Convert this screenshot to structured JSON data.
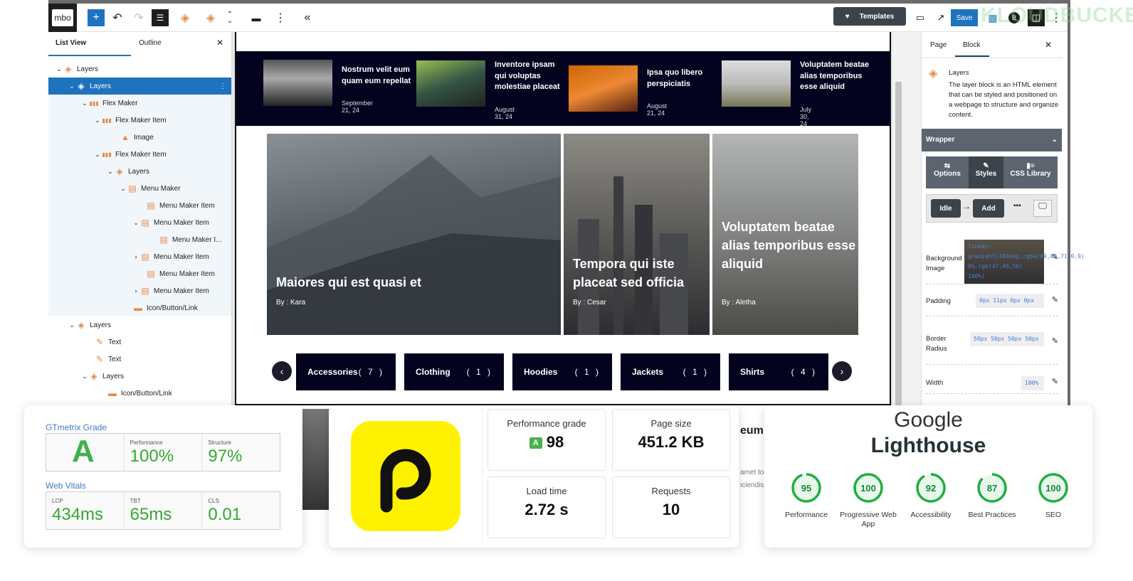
{
  "toolbar": {
    "logo": "mbo",
    "add": "+",
    "undo": "↶",
    "redo": "↷",
    "more": "⋮",
    "collapse": "«",
    "templates": "Templates",
    "save": "Save",
    "watermark": "KLOUDBUCKET"
  },
  "left": {
    "tabs": [
      "List View",
      "Outline"
    ],
    "close": "✕",
    "tree": [
      {
        "label": "Layers",
        "level": 0,
        "chev": "down",
        "icon": "layers"
      },
      {
        "label": "Layers",
        "level": 1,
        "chev": "down",
        "icon": "layers",
        "selected": true
      },
      {
        "label": "Flex Maker",
        "level": 2,
        "chev": "down",
        "icon": "flex"
      },
      {
        "label": "Flex Maker Item",
        "level": 3,
        "chev": "down",
        "icon": "flex"
      },
      {
        "label": "Image",
        "level": 4,
        "chev": "",
        "icon": "image"
      },
      {
        "label": "Flex Maker Item",
        "level": 3,
        "chev": "down",
        "icon": "flex"
      },
      {
        "label": "Layers",
        "level": 4,
        "chev": "down",
        "icon": "layers"
      },
      {
        "label": "Menu Maker",
        "level": 5,
        "chev": "down",
        "icon": "menu"
      },
      {
        "label": "Menu Maker Item",
        "level": 6,
        "chev": "",
        "icon": "menu"
      },
      {
        "label": "Menu Maker Item",
        "level": 6,
        "chev": "down",
        "icon": "menu"
      },
      {
        "label": "Menu Maker I...",
        "level": 7,
        "chev": "",
        "icon": "menu"
      },
      {
        "label": "Menu Maker Item",
        "level": 6,
        "chev": "right",
        "icon": "menu"
      },
      {
        "label": "Menu Maker Item",
        "level": 6,
        "chev": "",
        "icon": "menu"
      },
      {
        "label": "Menu Maker Item",
        "level": 6,
        "chev": "right",
        "icon": "menu"
      },
      {
        "label": "Icon/Button/Link",
        "level": 5,
        "chev": "",
        "icon": "link"
      },
      {
        "label": "Layers",
        "level": 1,
        "chev": "down",
        "icon": "layers"
      },
      {
        "label": "Text",
        "level": 2,
        "chev": "",
        "icon": "text"
      },
      {
        "label": "Text",
        "level": 2,
        "chev": "",
        "icon": "text"
      },
      {
        "label": "Layers",
        "level": 2,
        "chev": "down",
        "icon": "layers"
      },
      {
        "label": "Icon/Button/Link",
        "level": 3,
        "chev": "",
        "icon": "link"
      }
    ]
  },
  "posts": [
    {
      "title": "Nostrum velit eum quam eum repellat",
      "date": "September 21, 24"
    },
    {
      "title": "Inventore ipsam qui voluptas molestiae placeat",
      "date": "August 31, 24"
    },
    {
      "title": "Ipsa quo libero perspiciatis",
      "date": "August 21, 24"
    },
    {
      "title": "Voluptatem beatae alias temporibus esse aliquid",
      "date": "July 30, 24"
    }
  ],
  "heroes": [
    {
      "title": "Maiores qui est quasi et",
      "by": "By : Kara"
    },
    {
      "title": "Tempora qui iste placeat sed officia",
      "by": "By : Cesar"
    },
    {
      "title": "Voluptatem beatae alias temporibus esse aliquid",
      "by": "By : Aletha"
    }
  ],
  "categories": [
    {
      "name": "Accessories",
      "count": "( 7 )"
    },
    {
      "name": "Clothing",
      "count": "( 1 )"
    },
    {
      "name": "Hoodies",
      "count": "( 1 )"
    },
    {
      "name": "Jackets",
      "count": "( 1 )"
    },
    {
      "name": "Shirts",
      "count": "( 4 )"
    }
  ],
  "behind": {
    "heading": "eum",
    "line1": "amet to",
    "line2": "iciendis"
  },
  "right": {
    "tabs": [
      "Page",
      "Block"
    ],
    "close": "✕",
    "block_name": "Layers",
    "block_desc": "The layer block is an HTML element that can be styled and positioned on a webpage to structure and organize content.",
    "wrapper": "Wrapper",
    "style_tabs": [
      "Options",
      "Styles",
      "CSS Library"
    ],
    "state_idle": "Idle",
    "state_add": "Add",
    "props": [
      {
        "label": "Background Image",
        "value": "linear-gradient(180deg,rgba(89,82,71,0.9) 0%,rgb(47,46,50) 100%)"
      },
      {
        "label": "Padding",
        "value": "0px 11px 0px 0px"
      },
      {
        "label": "Border Radius",
        "value": "50px 50px 50px 50px"
      },
      {
        "label": "Width",
        "value": "100%"
      }
    ]
  },
  "gtmetrix": {
    "grade_title": "GTmetrix Grade",
    "grade": "A",
    "performance_label": "Performance",
    "performance": "100%",
    "structure_label": "Structure",
    "structure": "97%",
    "vitals_title": "Web Vitals",
    "lcp_label": "LCP",
    "lcp": "434ms",
    "tbt_label": "TBT",
    "tbt": "65ms",
    "cls_label": "CLS",
    "cls": "0.01"
  },
  "pingdom": {
    "logo": "p",
    "perf_label": "Performance grade",
    "perf_grade": "A",
    "perf": "98",
    "size_label": "Page size",
    "size": "451.2 KB",
    "load_label": "Load time",
    "load": "2.72 s",
    "req_label": "Requests",
    "req": "10"
  },
  "lighthouse": {
    "title1": "Google",
    "title2": "Lighthouse",
    "scores": [
      {
        "label": "Performance",
        "value": 95
      },
      {
        "label": "Progressive Web App",
        "value": 100
      },
      {
        "label": "Accessibility",
        "value": 92
      },
      {
        "label": "Best Practices",
        "value": 87
      },
      {
        "label": "SEO",
        "value": 100
      }
    ]
  },
  "colors": {
    "accent": "#1e73be",
    "navy": "#03031f",
    "orange": "#e38b4a",
    "green": "#34a832",
    "pingdom_yellow": "#fff200"
  }
}
